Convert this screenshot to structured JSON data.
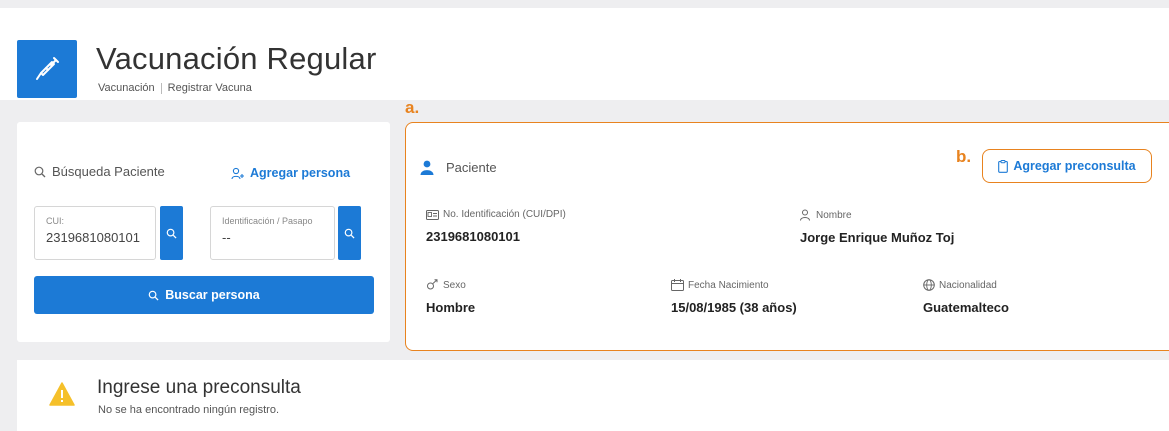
{
  "header": {
    "title": "Vacunación Regular",
    "breadcrumb": [
      "Vacunación",
      "Registrar Vacuna"
    ],
    "icon": "syringe-icon"
  },
  "search": {
    "title": "Búsqueda Paciente",
    "add_person": "Agregar persona",
    "cui_label": "CUI:",
    "cui_value": "2319681080101",
    "id_label": "Identificación / Pasapo",
    "id_value": "--",
    "search_button": "Buscar persona"
  },
  "annotations": {
    "a": "a.",
    "b": "b."
  },
  "patient": {
    "title": "Paciente",
    "add_preconsulta": "Agregar preconsulta",
    "id_label": "No. Identificación (CUI/DPI)",
    "id_value": "2319681080101",
    "name_label": "Nombre",
    "name_value": "Jorge Enrique Muñoz Toj",
    "sex_label": "Sexo",
    "sex_value": "Hombre",
    "dob_label": "Fecha Nacimiento",
    "dob_value": "15/08/1985 (38 años)",
    "nat_label": "Nacionalidad",
    "nat_value": "Guatemalteco"
  },
  "notice": {
    "title": "Ingrese una preconsulta",
    "subtitle": "No se ha encontrado ningún registro."
  },
  "colors": {
    "primary": "#1c7ad6",
    "highlight": "#e8831f",
    "warning": "#f5c02a"
  }
}
